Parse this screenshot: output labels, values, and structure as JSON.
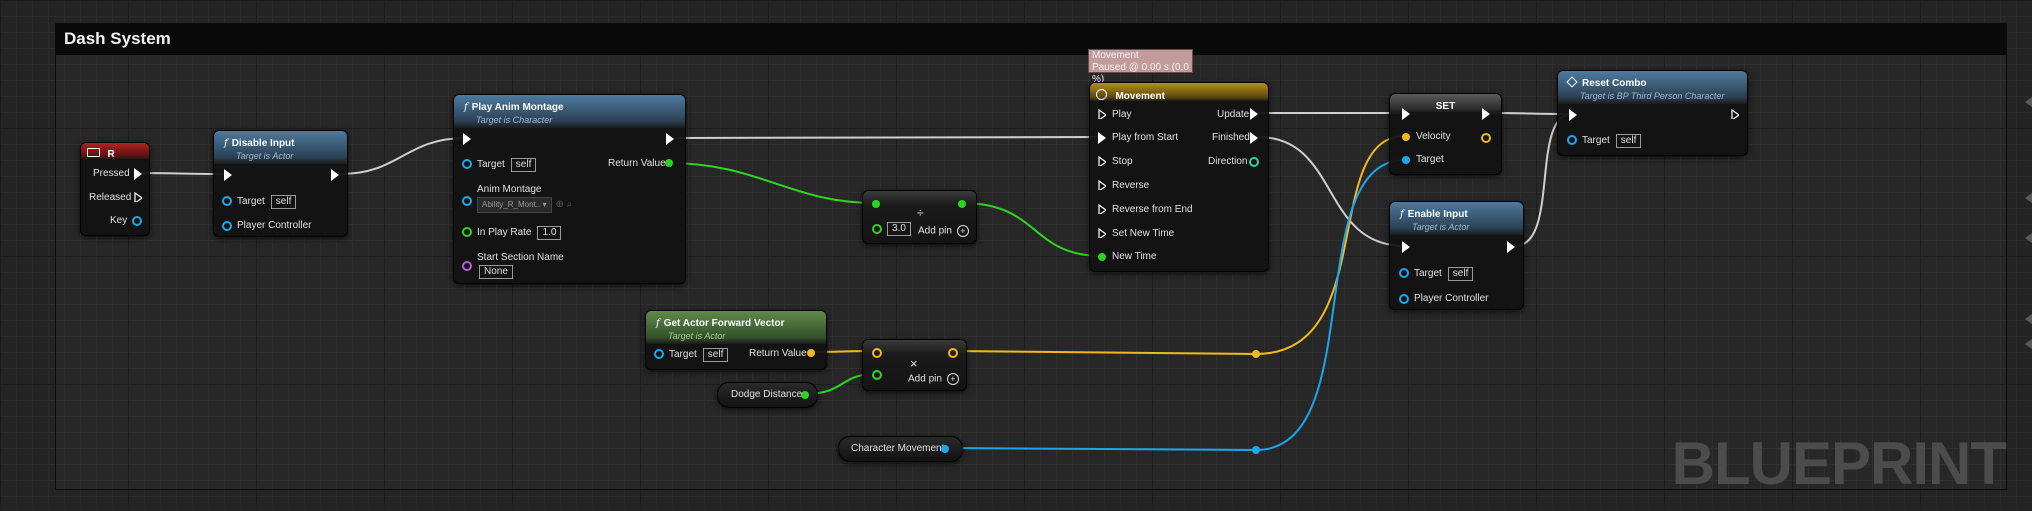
{
  "comment": {
    "title": "Dash System"
  },
  "watermark": "BLUEPRINT",
  "colors": {
    "exec": "#ffffff",
    "object": "#1aa7ec",
    "vector": "#f4b71d",
    "float": "#2fd420",
    "name": "#b55cd6",
    "wire_exec": "#c8c8c8"
  },
  "key_event": {
    "title": "R",
    "icon": "keyboard-icon",
    "pins": {
      "pressed": "Pressed",
      "released": "Released",
      "key": "Key"
    }
  },
  "disable_input": {
    "title": "Disable Input",
    "subtitle": "Target is Actor",
    "target_label": "Target",
    "target_value": "self",
    "pc_label": "Player Controller"
  },
  "play_anim": {
    "title": "Play Anim Montage",
    "subtitle": "Target is Character",
    "target_label": "Target",
    "target_value": "self",
    "anim_label": "Anim Montage",
    "anim_value": "Ability_R_Mont..",
    "rate_label": "In Play Rate",
    "rate_value": "1.0",
    "section_label": "Start Section Name",
    "section_value": "None",
    "return_label": "Return Value"
  },
  "divide_node": {
    "symbol": "÷",
    "value": "3.0",
    "add_pin": "Add pin"
  },
  "actor_fwd": {
    "title": "Get Actor Forward Vector",
    "subtitle": "Target is Actor",
    "target_label": "Target",
    "target_value": "self",
    "return_label": "Return Value"
  },
  "multiply_node": {
    "symbol": "×",
    "add_pin": "Add pin"
  },
  "dodge_distance": {
    "label": "Dodge Distance"
  },
  "char_movement": {
    "label": "Character Movement"
  },
  "timeline_tooltip": {
    "line1": "Movement",
    "line2": "Paused @ 0.00 s (0.0 %)"
  },
  "timeline": {
    "title": "Movement",
    "icon": "clock-icon",
    "inputs": [
      "Play",
      "Play from Start",
      "Stop",
      "Reverse",
      "Reverse from End",
      "Set New Time",
      "New Time"
    ],
    "outputs": {
      "update": "Update",
      "finished": "Finished",
      "direction": "Direction"
    }
  },
  "set_node": {
    "title": "SET",
    "velocity": "Velocity",
    "target": "Target"
  },
  "enable_input": {
    "title": "Enable Input",
    "subtitle": "Target is Actor",
    "target_label": "Target",
    "target_value": "self",
    "pc_label": "Player Controller"
  },
  "reset_combo": {
    "title": "Reset Combo",
    "subtitle": "Target is BP Third Person Character",
    "icon": "function-icon",
    "target_label": "Target",
    "target_value": "self"
  }
}
